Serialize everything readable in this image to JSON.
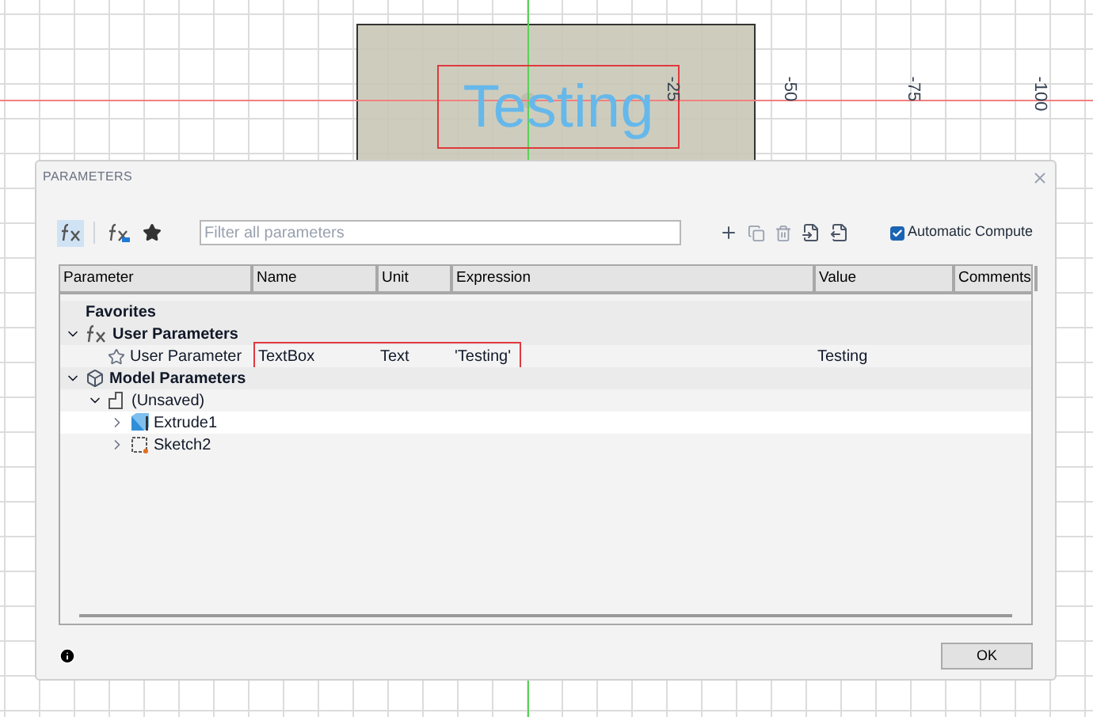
{
  "viewport": {
    "sketch_text": "Testing",
    "axis_labels": [
      "-25",
      "-50",
      "-75",
      "-100"
    ]
  },
  "dialog": {
    "title": "PARAMETERS",
    "toolbar": {
      "filters": [
        {
          "kind": "all",
          "selected": true
        },
        {
          "kind": "user",
          "selected": false
        },
        {
          "kind": "favorites",
          "selected": false
        }
      ],
      "search": {
        "placeholder": "Filter all parameters"
      },
      "auto_compute": {
        "label": "Automatic Compute",
        "checked": true
      }
    },
    "table": {
      "columns": [
        "Parameter",
        "Name",
        "Unit",
        "Expression",
        "Value",
        "Comments"
      ],
      "rows": [
        {
          "kind": "favorites",
          "label": "Favorites"
        },
        {
          "kind": "user-group",
          "label": "User Parameters",
          "expanded": true,
          "children": [
            {
              "kind": "user-param",
              "label": "User Parameter",
              "name": "TextBox",
              "unit": "Text",
              "expression": "'Testing'",
              "value": "Testing",
              "highlighted": true
            }
          ]
        },
        {
          "kind": "model-group",
          "label": "Model Parameters",
          "expanded": true,
          "children": [
            {
              "kind": "component",
              "label": "(Unsaved)",
              "expanded": true,
              "children": [
                {
                  "kind": "body",
                  "label": "Extrude1",
                  "expanded": false,
                  "selected": true
                },
                {
                  "kind": "sketch",
                  "label": "Sketch2",
                  "expanded": false,
                  "selected": false
                }
              ]
            }
          ]
        }
      ]
    },
    "ok_button": "OK"
  }
}
